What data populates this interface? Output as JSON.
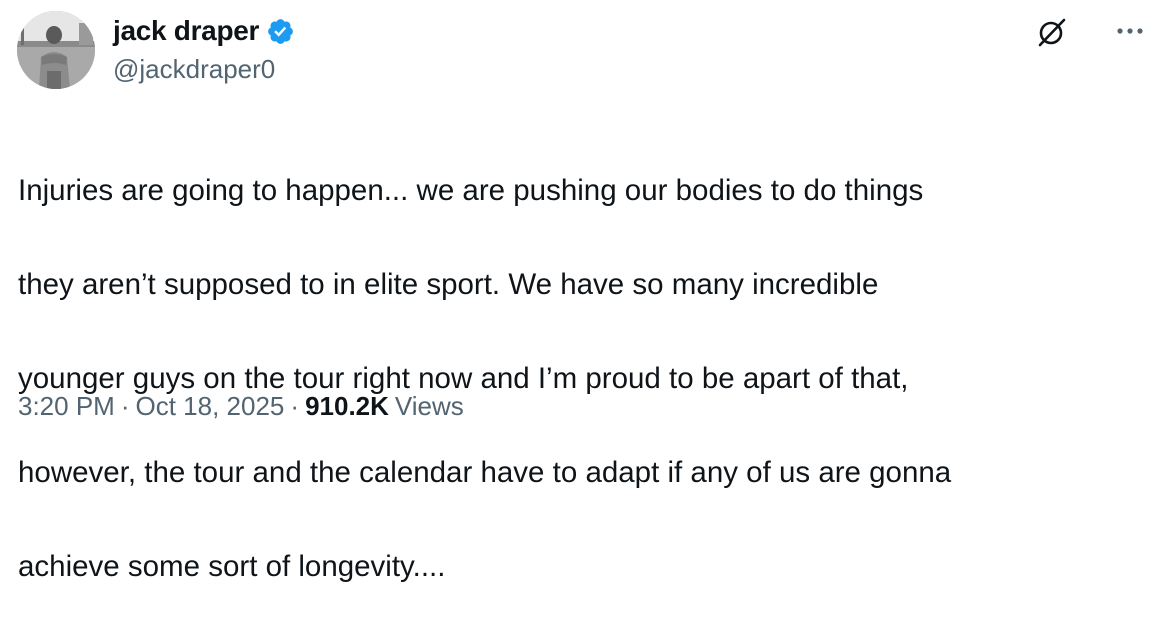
{
  "author": {
    "display_name": "jack draper",
    "handle": "@jackdraper0",
    "verified": true,
    "avatar_icon": "profile-photo"
  },
  "actions": {
    "grok_icon": "grok-icon",
    "more_icon": "more-dots-icon"
  },
  "tweet": {
    "lines": [
      "Injuries are going to happen... we are pushing our bodies to do things",
      "they aren’t supposed to in elite sport. We have so many incredible",
      "younger guys on the tour right now and I’m proud to be apart of that,",
      "however, the tour and the calendar have to adapt if any of us are gonna",
      "achieve some sort of longevity...."
    ]
  },
  "meta": {
    "time": "3:20 PM",
    "separator": "·",
    "date": "Oct 18, 2025",
    "views_count": "910.2K",
    "views_label": "Views"
  },
  "colors": {
    "text_primary": "#0f1419",
    "text_secondary": "#536471",
    "verified_blue": "#1d9bf0"
  }
}
